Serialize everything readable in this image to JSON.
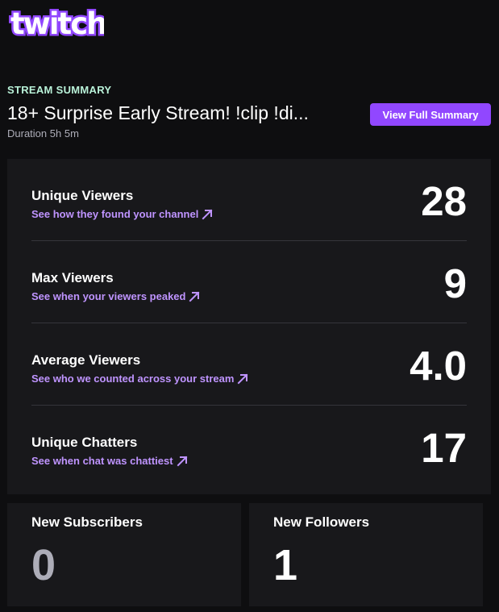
{
  "brand": {
    "logo_text": "twitch",
    "color": "#9147ff"
  },
  "header": {
    "eyebrow": "STREAM SUMMARY",
    "title": "18+ Surprise Early Stream! !clip !di...",
    "duration_label": "Duration",
    "duration_value": "5h 5m",
    "button_label": "View Full Summary"
  },
  "stats": [
    {
      "label": "Unique Viewers",
      "link": "See how they found your channel",
      "value": "28"
    },
    {
      "label": "Max Viewers",
      "link": "See when your viewers peaked",
      "value": "9"
    },
    {
      "label": "Average Viewers",
      "link": "See who we counted across your stream",
      "value": "4.0"
    },
    {
      "label": "Unique Chatters",
      "link": "See when chat was chattiest",
      "value": "17"
    }
  ],
  "cards": [
    {
      "label": "New Subscribers",
      "value": "0",
      "value_color": "#adadb8"
    },
    {
      "label": "New Followers",
      "value": "1",
      "value_color": "#ffffff"
    }
  ],
  "colors": {
    "background": "#0e0e10",
    "card": "#18181b",
    "link": "#bf94ff",
    "eyebrow": "#b9f2d9",
    "button": "#9147ff"
  },
  "icons": [
    "twitch-logo",
    "arrow-up-right-icon"
  ]
}
